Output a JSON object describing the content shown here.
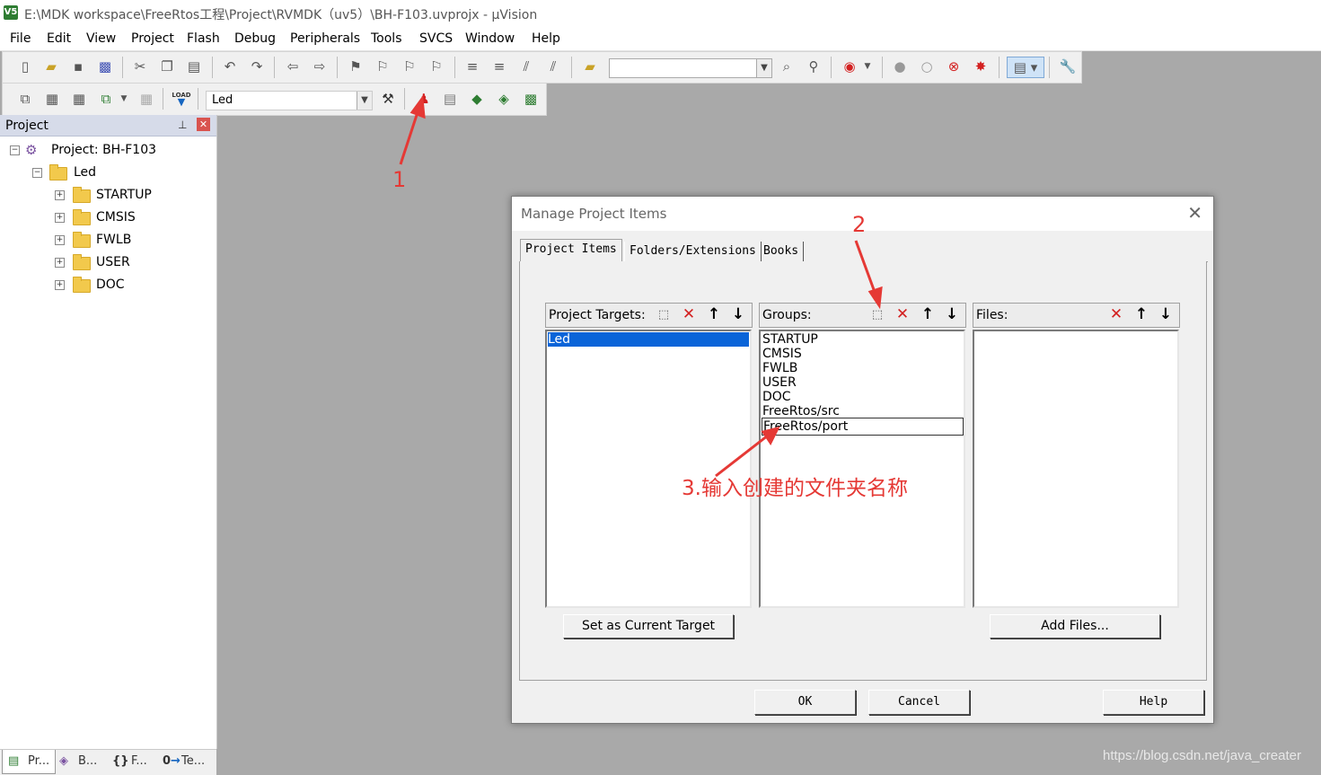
{
  "window": {
    "app_icon": "V5",
    "title": "E:\\MDK workspace\\FreeRtos工程\\Project\\RVMDK（uv5）\\BH-F103.uvprojx - µVision"
  },
  "menu": [
    "File",
    "Edit",
    "View",
    "Project",
    "Flash",
    "Debug",
    "Peripherals",
    "Tools",
    "SVCS",
    "Window",
    "Help"
  ],
  "toolbar2": {
    "target_value": "Led",
    "load_label": "LOAD"
  },
  "project_panel": {
    "title": "Project",
    "root": "Project: BH-F103",
    "target": "Led",
    "groups": [
      "STARTUP",
      "CMSIS",
      "FWLB",
      "USER",
      "DOC"
    ]
  },
  "bottom_tabs": [
    {
      "icon": "project-tab-icon",
      "label": "Pr..."
    },
    {
      "icon": "books-tab-icon",
      "label": "B..."
    },
    {
      "icon": "functions-tab-icon",
      "label": "F..."
    },
    {
      "icon": "templates-tab-icon",
      "label": "Te..."
    }
  ],
  "bottom_tab_glyphs": [
    "{}",
    "0"
  ],
  "dialog": {
    "title": "Manage Project Items",
    "tabs": [
      "Project Items",
      "Folders/Extensions",
      "Books"
    ],
    "targets": {
      "label": "Project Targets:",
      "items": [
        "Led"
      ],
      "selected": "Led"
    },
    "groups": {
      "label": "Groups:",
      "items": [
        "STARTUP",
        "CMSIS",
        "FWLB",
        "USER",
        "DOC",
        "FreeRtos/src"
      ],
      "editing_value": "FreeRtos/port"
    },
    "files": {
      "label": "Files:",
      "items": []
    },
    "buttons": {
      "set_target": "Set as Current Target",
      "add_files": "Add Files...",
      "ok": "OK",
      "cancel": "Cancel",
      "help": "Help"
    }
  },
  "annotations": {
    "a1": "1",
    "a2": "2",
    "a3": "3.输入创建的文件夹名称",
    "color": "#e53935"
  },
  "watermark": "https://blog.csdn.net/java_creater"
}
